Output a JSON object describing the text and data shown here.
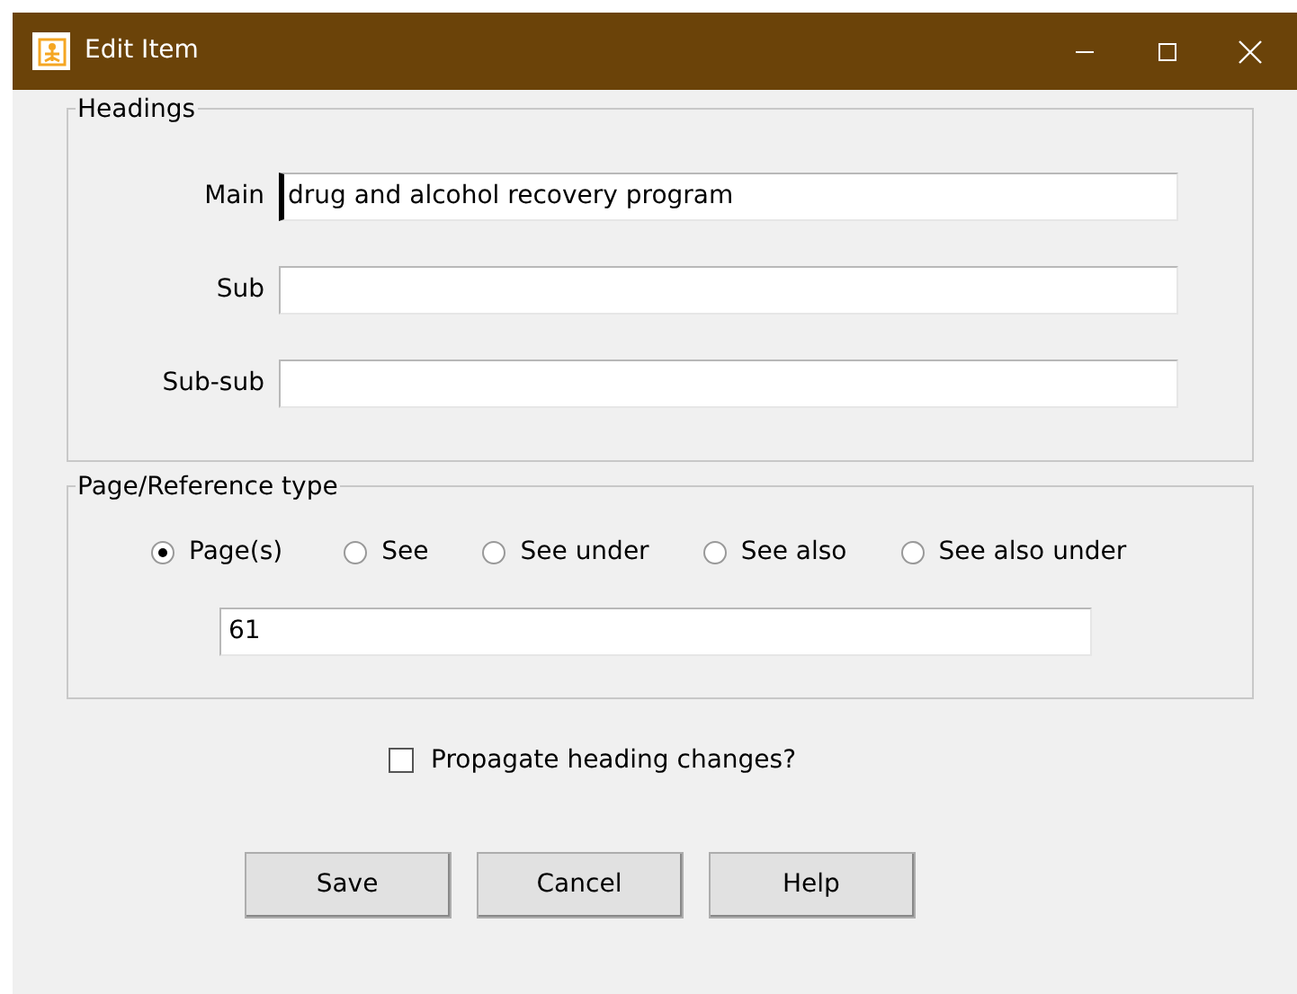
{
  "window": {
    "title": "Edit Item"
  },
  "headings": {
    "legend": "Headings",
    "fields": [
      {
        "label": "Main",
        "value": "drug and alcohol recovery program",
        "focused": true
      },
      {
        "label": "Sub",
        "focused": false
      },
      {
        "label": "Sub-sub",
        "focused": false
      }
    ]
  },
  "reference": {
    "legend": "Page/Reference type",
    "options": [
      {
        "label": "Page(s)",
        "selected": true
      },
      {
        "label": "See",
        "selected": false
      },
      {
        "label": "See under",
        "selected": false
      },
      {
        "label": "See also",
        "selected": false
      },
      {
        "label": "See also under",
        "selected": false
      }
    ],
    "value": "61"
  },
  "propagate": {
    "label": "Propagate heading changes?",
    "checked": false
  },
  "buttons": [
    "Save",
    "Cancel",
    "Help"
  ]
}
